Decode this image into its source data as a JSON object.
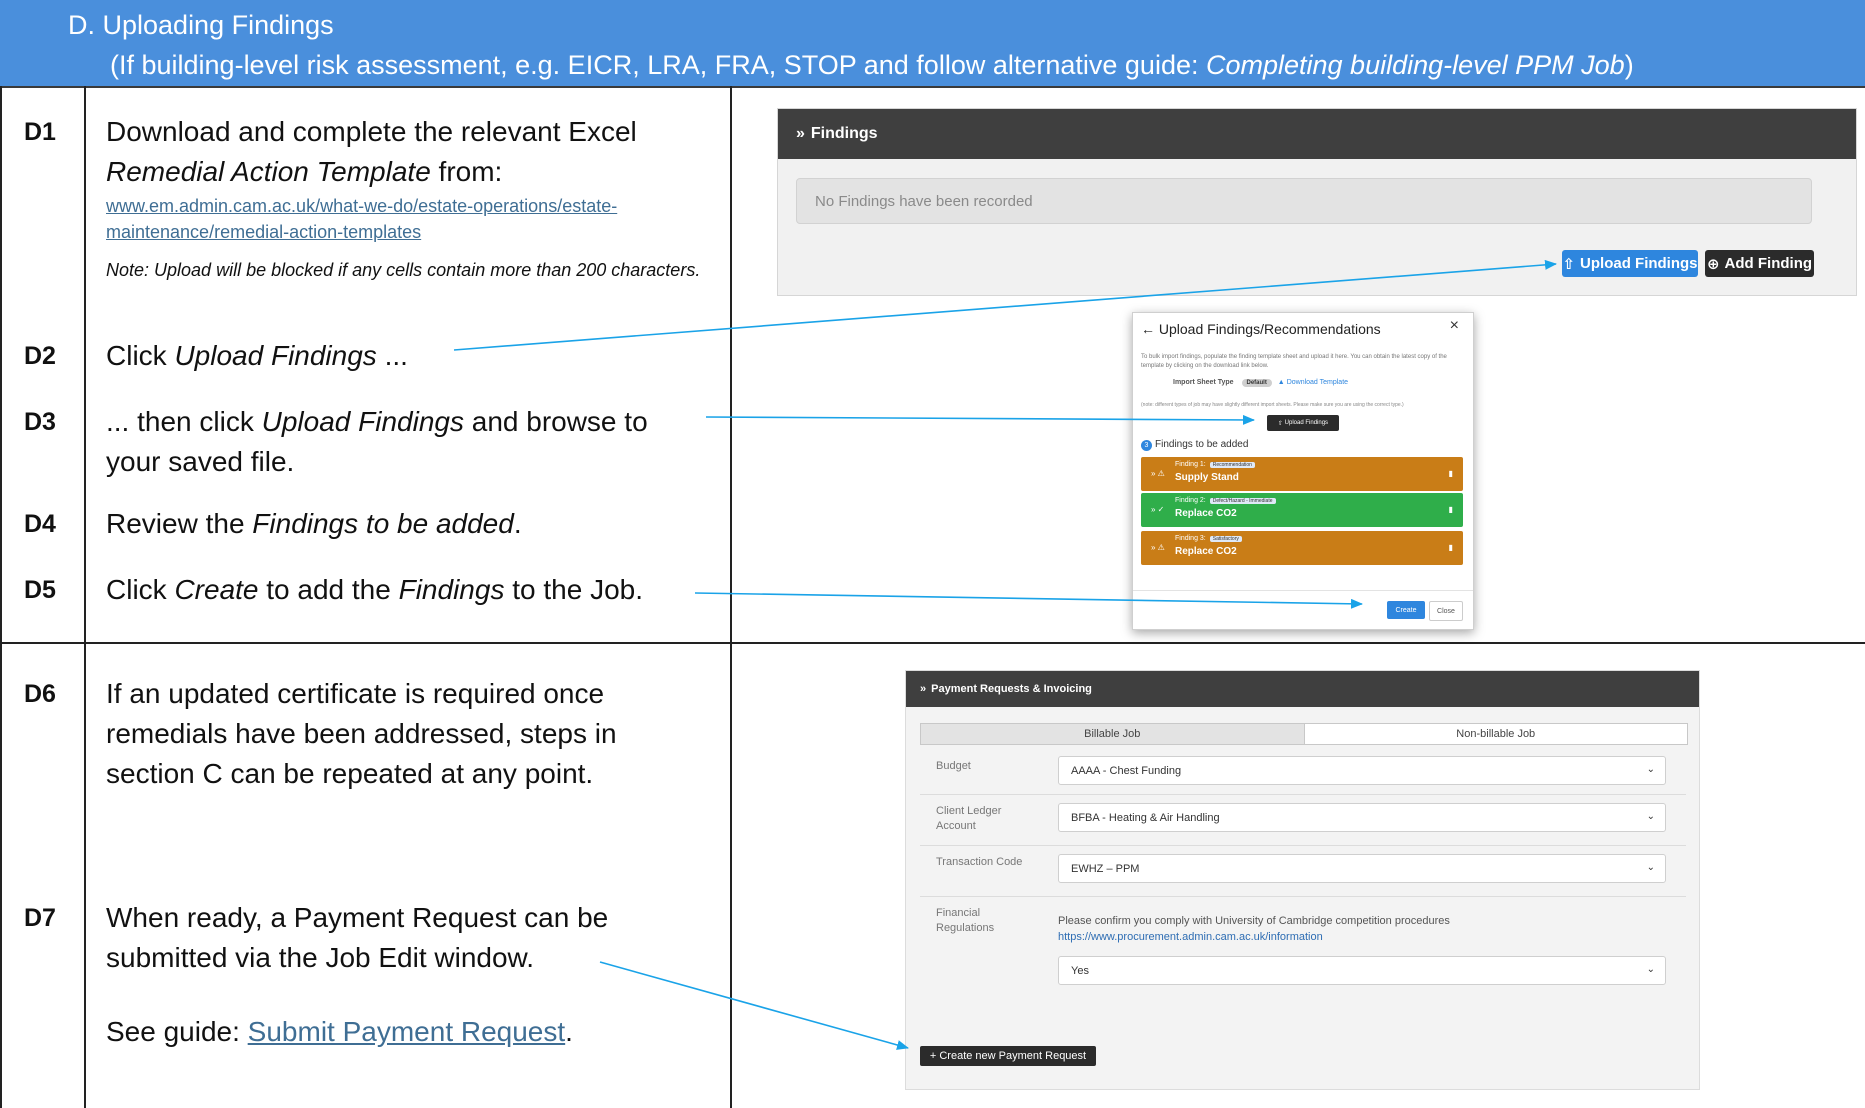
{
  "header": {
    "section_title": "D.  Uploading Findings",
    "subtitle_prefix": "(If building-level risk assessment, e.g. EICR, LRA, FRA, STOP and follow alternative guide: ",
    "subtitle_guide": "Completing building-level PPM Job",
    "subtitle_suffix": ")"
  },
  "steps": {
    "d1": {
      "id": "D1",
      "line1": "Download and complete the relevant Excel",
      "template_name": "Remedial Action Template",
      "from": " from:",
      "link": "www.em.admin.cam.ac.uk/what-we-do/estate-operations/estate-maintenance/remedial-action-templates",
      "note": "Note: Upload will be blocked if any cells contain more than 200 characters."
    },
    "d2": {
      "id": "D2",
      "pre": "Click ",
      "action": "Upload Findings",
      "post": " ..."
    },
    "d3": {
      "id": "D3",
      "pre": "... then click ",
      "action": "Upload Findings",
      "post": " and browse to",
      "line2": "your saved file."
    },
    "d4": {
      "id": "D4",
      "pre": "Review the ",
      "action": "Findings to be added",
      "post": "."
    },
    "d5": {
      "id": "D5",
      "pre": "Click ",
      "action": "Create",
      "mid": " to add the ",
      "obj": "Findings",
      "post": " to the Job."
    },
    "d6": {
      "id": "D6",
      "line1": "If an updated certificate is required once",
      "line2": "remedials have been addressed, steps in",
      "line3": "section C can be repeated at any point."
    },
    "d7": {
      "id": "D7",
      "line1": "When ready, a Payment Request can be",
      "line2": "submitted via the Job Edit window.",
      "see_pre": "See guide: ",
      "see_link": "Submit Payment Request",
      "see_post": "."
    }
  },
  "findings_panel": {
    "title": "Findings",
    "empty_text": "No Findings have been recorded",
    "upload_button": "Upload Findings",
    "add_button": "Add Finding"
  },
  "upload_modal": {
    "title": "Upload Findings/Recommendations",
    "close": "×",
    "description": "To bulk import findings, populate the finding template sheet and upload it here. You can obtain the latest copy of the template by clicking on the download link below.",
    "import_label": "Import Sheet Type",
    "import_value": "Default",
    "download_link": "Download Template",
    "type_note": "(note: different types of job may have slightly different import sheets. Please make sure you are using the correct type.)",
    "upload_button": "Upload Findings",
    "findings_count": "3",
    "findings_heading": "Findings to be added",
    "findings": [
      {
        "label": "Finding 1:",
        "tag": "Recommendation",
        "title": "Supply Stand",
        "color": "#c97d17"
      },
      {
        "label": "Finding 2:",
        "tag": "Defect/Hazard - Immediate",
        "title": "Replace CO2",
        "color": "#2fae4a"
      },
      {
        "label": "Finding 3:",
        "tag": "Satisfactory",
        "title": "Replace CO2",
        "color": "#c97d17"
      }
    ],
    "create_button": "Create",
    "close_button": "Close"
  },
  "payment_panel": {
    "title": "Payment Requests & Invoicing",
    "tab_billable": "Billable Job",
    "tab_nonbillable": "Non-billable Job",
    "budget_label": "Budget",
    "budget_value": "AAAA - Chest Funding",
    "ledger_label": "Client Ledger Account",
    "ledger_value": "BFBA - Heating & Air Handling",
    "transaction_label": "Transaction Code",
    "transaction_value": "EWHZ – PPM",
    "regs_label": "Financial Regulations",
    "regs_text": "Please confirm you comply with University of Cambridge competition procedures",
    "regs_link": "https://www.procurement.admin.cam.ac.uk/information",
    "regs_value": "Yes",
    "create_button": "+ Create new Payment Request"
  },
  "colors": {
    "header": "#4a8fdc",
    "arrow": "#1aa3e8",
    "orange": "#c97d17",
    "green": "#2fae4a"
  },
  "icons": [
    "chevron-down-icon",
    "upload-icon",
    "plus-circle-icon",
    "back-arrow-icon",
    "close-icon",
    "warning-icon",
    "check-icon",
    "trash-icon",
    "expand-icon"
  ]
}
